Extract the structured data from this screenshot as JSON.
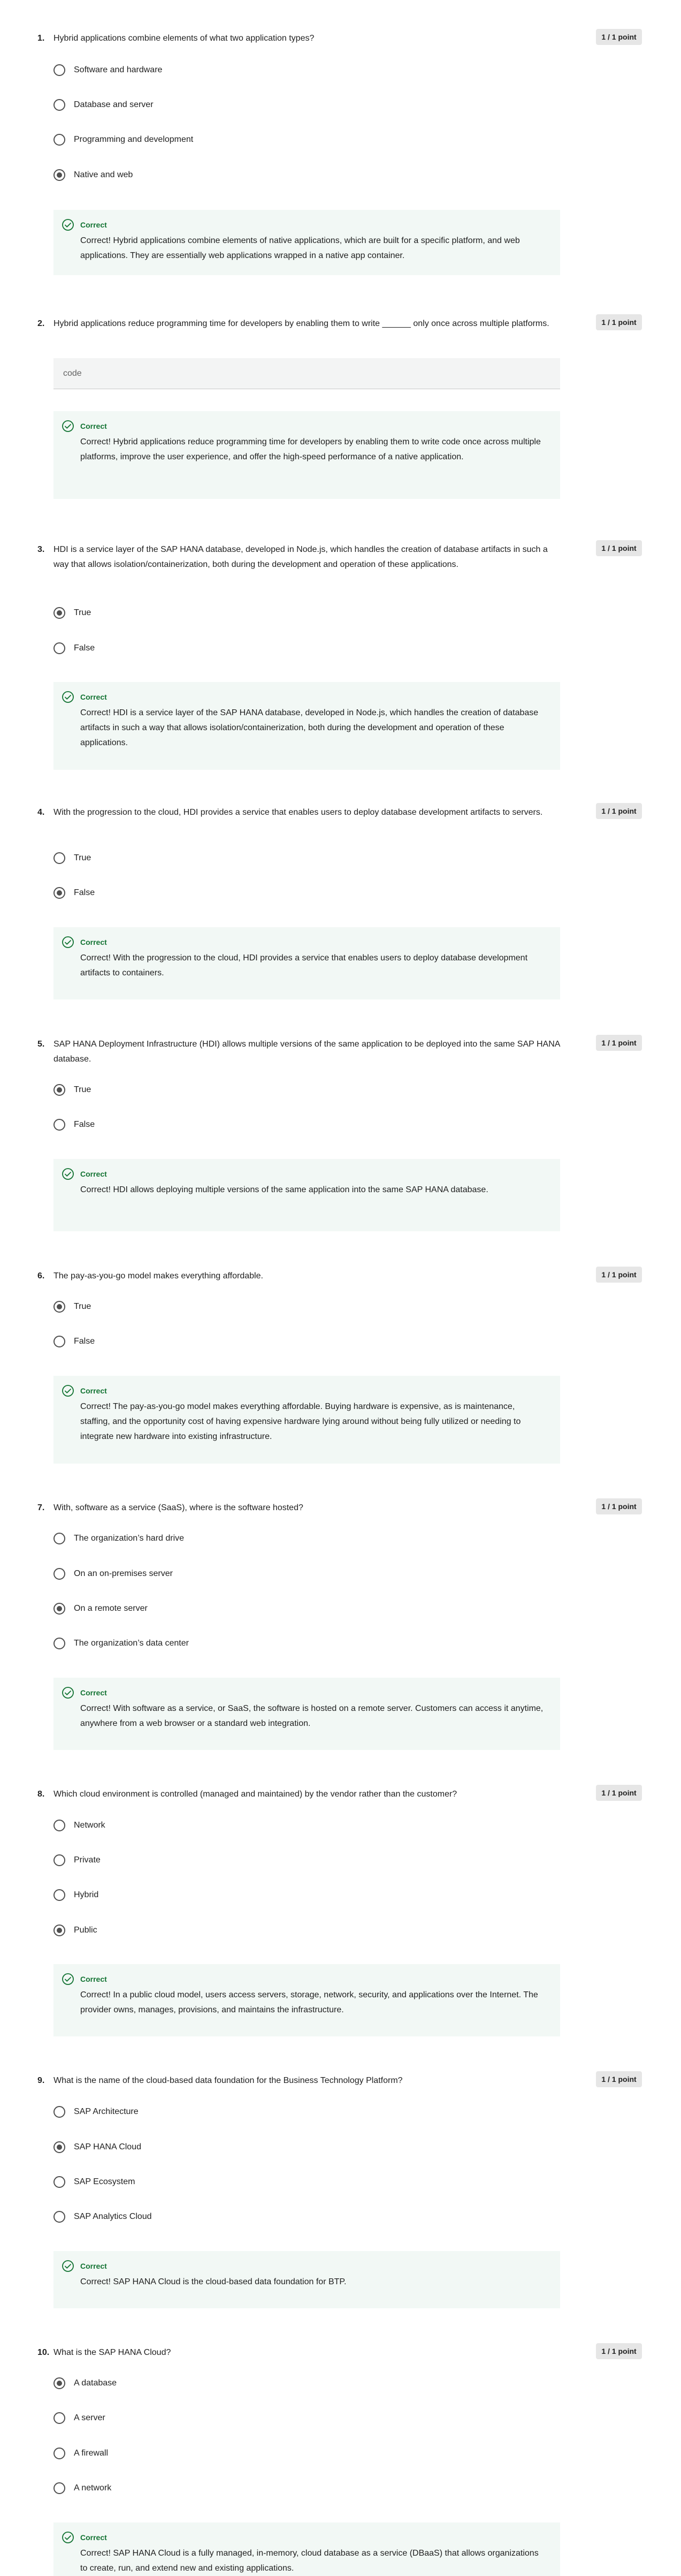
{
  "feedback_label": "Correct",
  "points_label": "1 / 1 point",
  "text_answer": "code",
  "questions": [
    {
      "number": "1.",
      "text": "Hybrid applications combine elements of what two application types?",
      "options": [
        "Software and hardware",
        "Database and server",
        "Programming and development",
        "Native and web"
      ],
      "selected": 3,
      "feedback": "Correct! Hybrid applications combine elements of native applications, which are built for a specific platform, and web applications. They are essentially web applications wrapped in a native app container."
    },
    {
      "number": "2.",
      "text": "Hybrid applications reduce programming time for developers by enabling them to write ______ only once across multiple platforms.",
      "feedback": "Correct! Hybrid applications reduce programming time for developers by enabling them to write code once across multiple platforms, improve the user experience, and offer the high-speed performance of a native application."
    },
    {
      "number": "3.",
      "text": "HDI is a service layer of the SAP HANA database, developed in Node.js, which handles the creation of database artifacts in such a way that allows isolation/containerization, both during the development and operation of these applications.",
      "options": [
        "True",
        "False"
      ],
      "selected": 0,
      "feedback": "Correct! HDI is a service layer of the SAP HANA database, developed in Node.js, which handles the creation of database artifacts in such a way that allows isolation/containerization, both during the development and operation of these applications."
    },
    {
      "number": "4.",
      "text": "With the progression to the cloud, HDI provides a service that enables users to deploy database development artifacts to servers.",
      "options": [
        "True",
        "False"
      ],
      "selected": 1,
      "feedback": "Correct! With the progression to the cloud, HDI provides a service that enables users to deploy database development artifacts to containers."
    },
    {
      "number": "5.",
      "text": "SAP HANA Deployment Infrastructure (HDI) allows multiple versions of the same application to be deployed into the same SAP HANA database.",
      "options": [
        "True",
        "False"
      ],
      "selected": 0,
      "feedback": "Correct! HDI allows deploying multiple versions of the same application into the same SAP HANA database."
    },
    {
      "number": "6.",
      "text": "The pay-as-you-go model makes everything affordable.",
      "options": [
        "True",
        "False"
      ],
      "selected": 0,
      "feedback": "Correct! The pay-as-you-go model makes everything affordable. Buying hardware is expensive, as is maintenance, staffing, and the opportunity cost of having expensive hardware lying around without being fully utilized or needing to integrate new hardware into existing infrastructure."
    },
    {
      "number": "7.",
      "text": "With, software as a service (SaaS), where is the software hosted?",
      "options": [
        "The organization’s hard drive",
        "On an on-premises server",
        "On a remote server",
        "The organization’s data center"
      ],
      "selected": 2,
      "feedback": "Correct! With software as a service, or SaaS, the software is hosted on a remote server. Customers can access it anytime, anywhere from a web browser or a standard web integration."
    },
    {
      "number": "8.",
      "text": "Which cloud environment is controlled (managed and maintained) by the vendor rather than the customer?",
      "options": [
        "Network",
        "Private",
        "Hybrid",
        "Public"
      ],
      "selected": 3,
      "feedback": "Correct! In a public cloud model, users access servers, storage, network, security, and applications over the Internet. The provider owns, manages, provisions, and maintains the infrastructure."
    },
    {
      "number": "9.",
      "text": "What is the name of the cloud-based data foundation for the Business Technology Platform?",
      "options": [
        "SAP Architecture",
        "SAP HANA Cloud",
        "SAP Ecosystem",
        "SAP Analytics Cloud"
      ],
      "selected": 1,
      "feedback": "Correct! SAP HANA Cloud is the cloud-based data foundation for BTP."
    },
    {
      "number": "10.",
      "text": "What is the SAP HANA Cloud?",
      "options": [
        "A database",
        "A server",
        "A firewall",
        "A network"
      ],
      "selected": 0,
      "feedback": "Correct! SAP HANA Cloud is a fully managed, in-memory, cloud database as a service (DBaaS) that allows organizations to create, run, and extend new and existing applications."
    }
  ]
}
